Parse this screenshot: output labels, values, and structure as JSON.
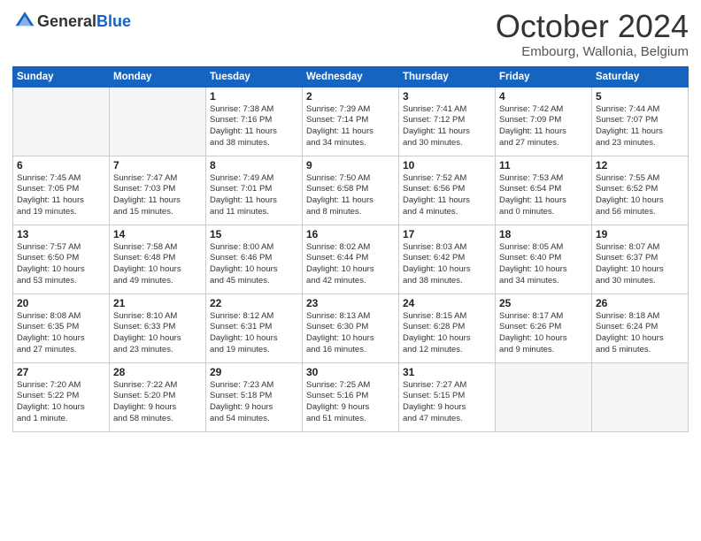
{
  "logo": {
    "general": "General",
    "blue": "Blue"
  },
  "header": {
    "month": "October 2024",
    "location": "Embourg, Wallonia, Belgium"
  },
  "weekdays": [
    "Sunday",
    "Monday",
    "Tuesday",
    "Wednesday",
    "Thursday",
    "Friday",
    "Saturday"
  ],
  "weeks": [
    [
      {
        "day": "",
        "sunrise": "",
        "sunset": "",
        "daylight": "",
        "empty": true
      },
      {
        "day": "",
        "sunrise": "",
        "sunset": "",
        "daylight": "",
        "empty": true
      },
      {
        "day": "1",
        "sunrise": "Sunrise: 7:38 AM",
        "sunset": "Sunset: 7:16 PM",
        "daylight": "Daylight: 11 hours",
        "daylight2": "and 38 minutes."
      },
      {
        "day": "2",
        "sunrise": "Sunrise: 7:39 AM",
        "sunset": "Sunset: 7:14 PM",
        "daylight": "Daylight: 11 hours",
        "daylight2": "and 34 minutes."
      },
      {
        "day": "3",
        "sunrise": "Sunrise: 7:41 AM",
        "sunset": "Sunset: 7:12 PM",
        "daylight": "Daylight: 11 hours",
        "daylight2": "and 30 minutes."
      },
      {
        "day": "4",
        "sunrise": "Sunrise: 7:42 AM",
        "sunset": "Sunset: 7:09 PM",
        "daylight": "Daylight: 11 hours",
        "daylight2": "and 27 minutes."
      },
      {
        "day": "5",
        "sunrise": "Sunrise: 7:44 AM",
        "sunset": "Sunset: 7:07 PM",
        "daylight": "Daylight: 11 hours",
        "daylight2": "and 23 minutes."
      }
    ],
    [
      {
        "day": "6",
        "sunrise": "Sunrise: 7:45 AM",
        "sunset": "Sunset: 7:05 PM",
        "daylight": "Daylight: 11 hours",
        "daylight2": "and 19 minutes."
      },
      {
        "day": "7",
        "sunrise": "Sunrise: 7:47 AM",
        "sunset": "Sunset: 7:03 PM",
        "daylight": "Daylight: 11 hours",
        "daylight2": "and 15 minutes."
      },
      {
        "day": "8",
        "sunrise": "Sunrise: 7:49 AM",
        "sunset": "Sunset: 7:01 PM",
        "daylight": "Daylight: 11 hours",
        "daylight2": "and 11 minutes."
      },
      {
        "day": "9",
        "sunrise": "Sunrise: 7:50 AM",
        "sunset": "Sunset: 6:58 PM",
        "daylight": "Daylight: 11 hours",
        "daylight2": "and 8 minutes."
      },
      {
        "day": "10",
        "sunrise": "Sunrise: 7:52 AM",
        "sunset": "Sunset: 6:56 PM",
        "daylight": "Daylight: 11 hours",
        "daylight2": "and 4 minutes."
      },
      {
        "day": "11",
        "sunrise": "Sunrise: 7:53 AM",
        "sunset": "Sunset: 6:54 PM",
        "daylight": "Daylight: 11 hours",
        "daylight2": "and 0 minutes."
      },
      {
        "day": "12",
        "sunrise": "Sunrise: 7:55 AM",
        "sunset": "Sunset: 6:52 PM",
        "daylight": "Daylight: 10 hours",
        "daylight2": "and 56 minutes."
      }
    ],
    [
      {
        "day": "13",
        "sunrise": "Sunrise: 7:57 AM",
        "sunset": "Sunset: 6:50 PM",
        "daylight": "Daylight: 10 hours",
        "daylight2": "and 53 minutes."
      },
      {
        "day": "14",
        "sunrise": "Sunrise: 7:58 AM",
        "sunset": "Sunset: 6:48 PM",
        "daylight": "Daylight: 10 hours",
        "daylight2": "and 49 minutes."
      },
      {
        "day": "15",
        "sunrise": "Sunrise: 8:00 AM",
        "sunset": "Sunset: 6:46 PM",
        "daylight": "Daylight: 10 hours",
        "daylight2": "and 45 minutes."
      },
      {
        "day": "16",
        "sunrise": "Sunrise: 8:02 AM",
        "sunset": "Sunset: 6:44 PM",
        "daylight": "Daylight: 10 hours",
        "daylight2": "and 42 minutes."
      },
      {
        "day": "17",
        "sunrise": "Sunrise: 8:03 AM",
        "sunset": "Sunset: 6:42 PM",
        "daylight": "Daylight: 10 hours",
        "daylight2": "and 38 minutes."
      },
      {
        "day": "18",
        "sunrise": "Sunrise: 8:05 AM",
        "sunset": "Sunset: 6:40 PM",
        "daylight": "Daylight: 10 hours",
        "daylight2": "and 34 minutes."
      },
      {
        "day": "19",
        "sunrise": "Sunrise: 8:07 AM",
        "sunset": "Sunset: 6:37 PM",
        "daylight": "Daylight: 10 hours",
        "daylight2": "and 30 minutes."
      }
    ],
    [
      {
        "day": "20",
        "sunrise": "Sunrise: 8:08 AM",
        "sunset": "Sunset: 6:35 PM",
        "daylight": "Daylight: 10 hours",
        "daylight2": "and 27 minutes."
      },
      {
        "day": "21",
        "sunrise": "Sunrise: 8:10 AM",
        "sunset": "Sunset: 6:33 PM",
        "daylight": "Daylight: 10 hours",
        "daylight2": "and 23 minutes."
      },
      {
        "day": "22",
        "sunrise": "Sunrise: 8:12 AM",
        "sunset": "Sunset: 6:31 PM",
        "daylight": "Daylight: 10 hours",
        "daylight2": "and 19 minutes."
      },
      {
        "day": "23",
        "sunrise": "Sunrise: 8:13 AM",
        "sunset": "Sunset: 6:30 PM",
        "daylight": "Daylight: 10 hours",
        "daylight2": "and 16 minutes."
      },
      {
        "day": "24",
        "sunrise": "Sunrise: 8:15 AM",
        "sunset": "Sunset: 6:28 PM",
        "daylight": "Daylight: 10 hours",
        "daylight2": "and 12 minutes."
      },
      {
        "day": "25",
        "sunrise": "Sunrise: 8:17 AM",
        "sunset": "Sunset: 6:26 PM",
        "daylight": "Daylight: 10 hours",
        "daylight2": "and 9 minutes."
      },
      {
        "day": "26",
        "sunrise": "Sunrise: 8:18 AM",
        "sunset": "Sunset: 6:24 PM",
        "daylight": "Daylight: 10 hours",
        "daylight2": "and 5 minutes."
      }
    ],
    [
      {
        "day": "27",
        "sunrise": "Sunrise: 7:20 AM",
        "sunset": "Sunset: 5:22 PM",
        "daylight": "Daylight: 10 hours",
        "daylight2": "and 1 minute."
      },
      {
        "day": "28",
        "sunrise": "Sunrise: 7:22 AM",
        "sunset": "Sunset: 5:20 PM",
        "daylight": "Daylight: 9 hours",
        "daylight2": "and 58 minutes."
      },
      {
        "day": "29",
        "sunrise": "Sunrise: 7:23 AM",
        "sunset": "Sunset: 5:18 PM",
        "daylight": "Daylight: 9 hours",
        "daylight2": "and 54 minutes."
      },
      {
        "day": "30",
        "sunrise": "Sunrise: 7:25 AM",
        "sunset": "Sunset: 5:16 PM",
        "daylight": "Daylight: 9 hours",
        "daylight2": "and 51 minutes."
      },
      {
        "day": "31",
        "sunrise": "Sunrise: 7:27 AM",
        "sunset": "Sunset: 5:15 PM",
        "daylight": "Daylight: 9 hours",
        "daylight2": "and 47 minutes."
      },
      {
        "day": "",
        "sunrise": "",
        "sunset": "",
        "daylight": "",
        "daylight2": "",
        "empty": true
      },
      {
        "day": "",
        "sunrise": "",
        "sunset": "",
        "daylight": "",
        "daylight2": "",
        "empty": true
      }
    ]
  ]
}
